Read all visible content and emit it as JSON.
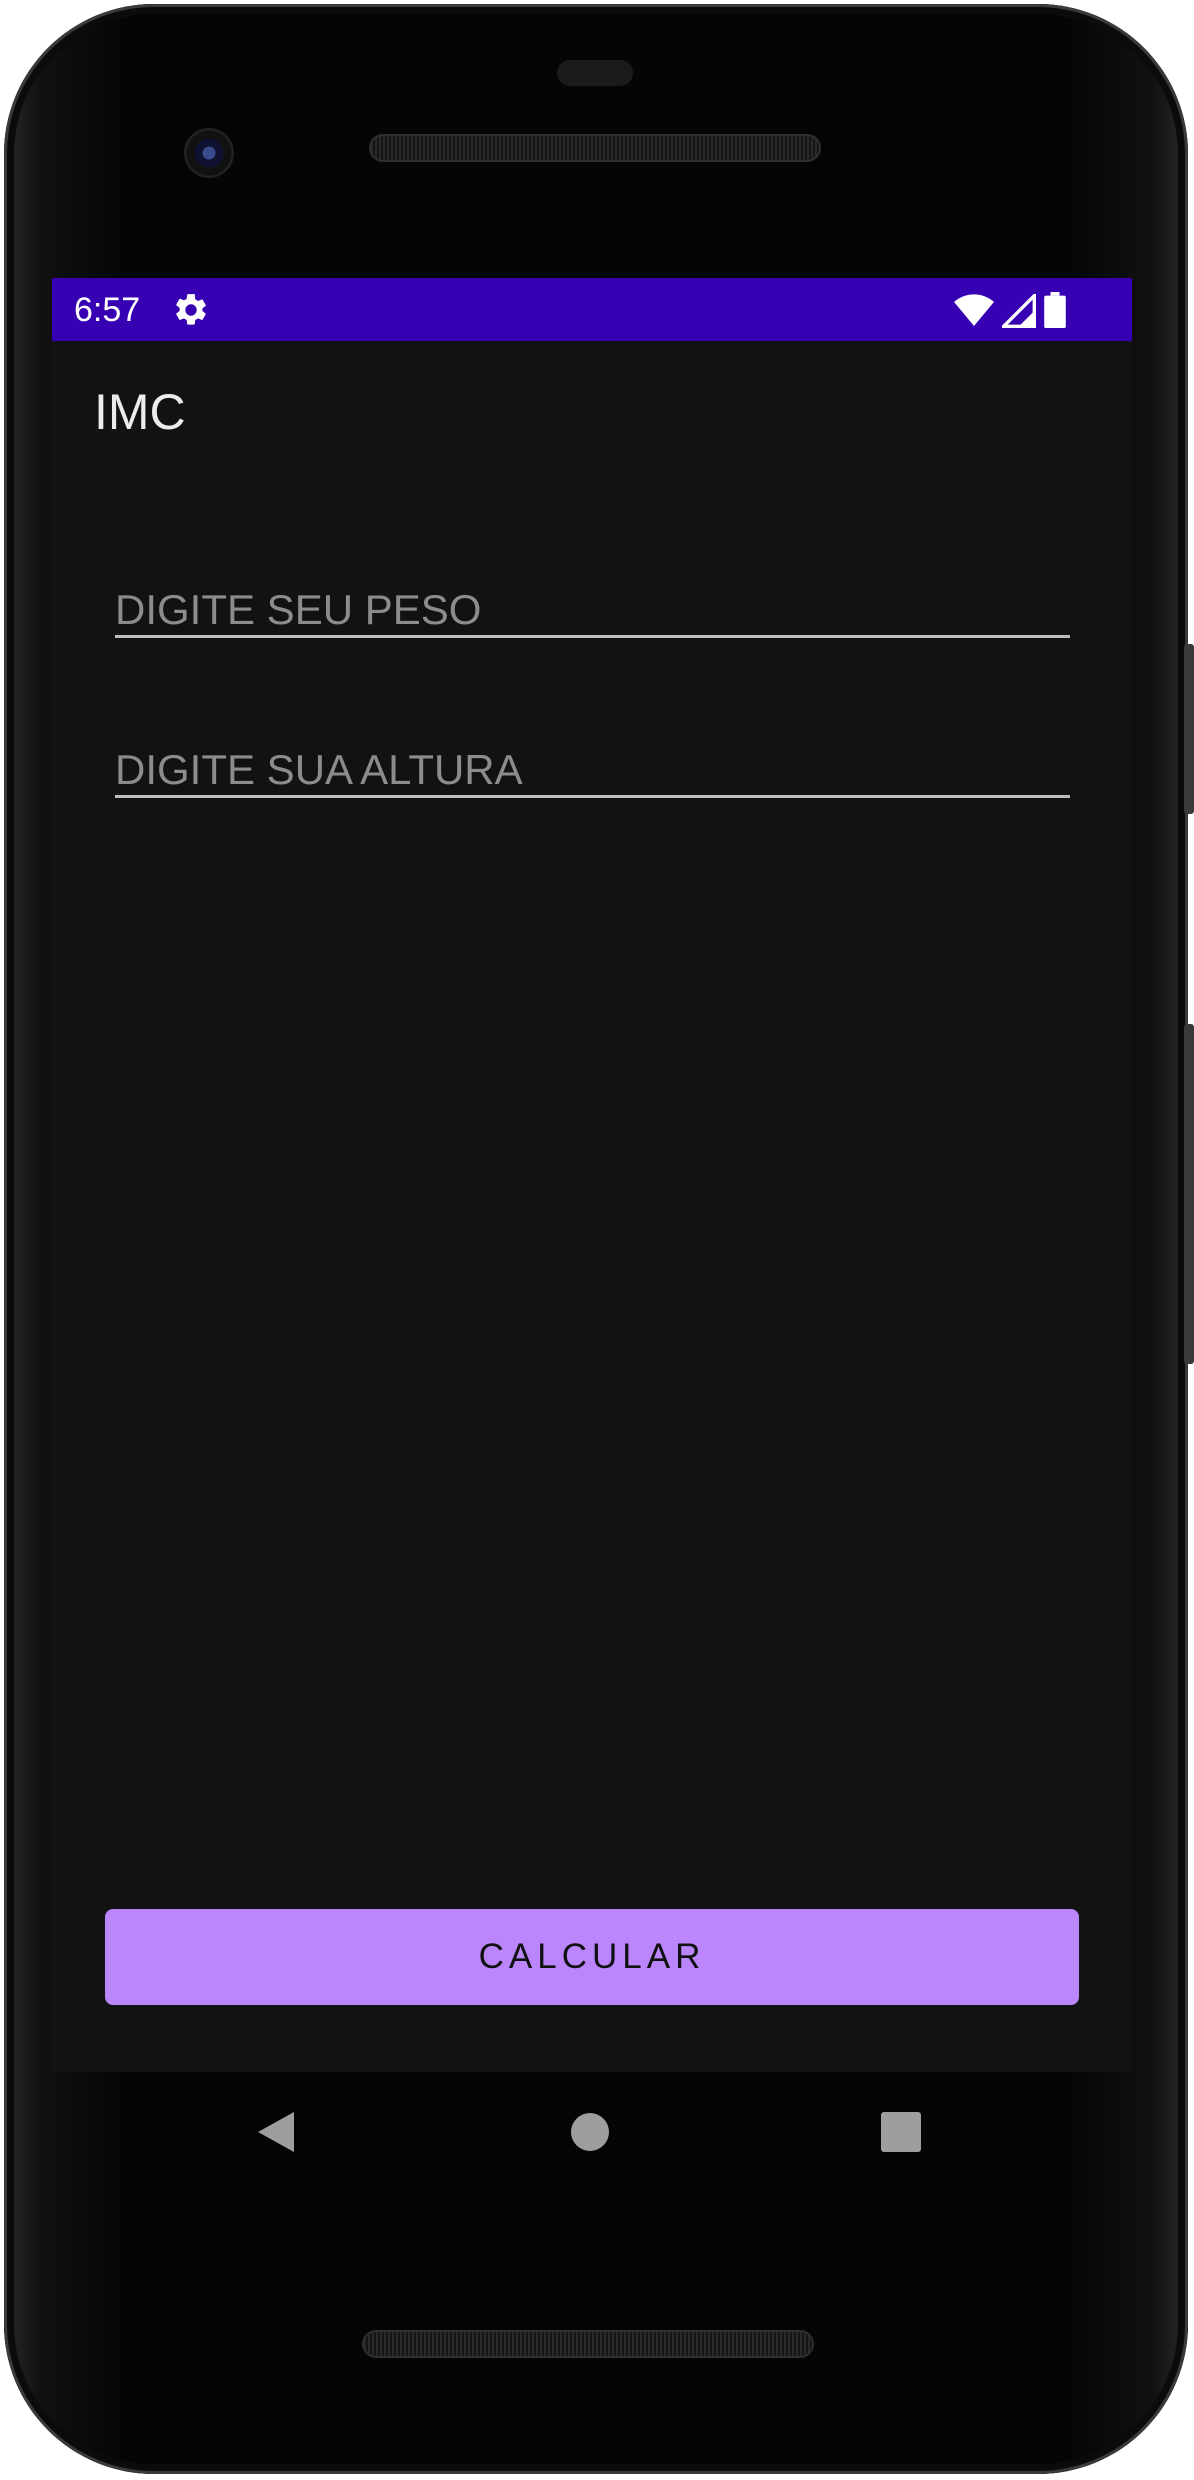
{
  "status_bar": {
    "time": "6:57",
    "icons": [
      "gear-icon",
      "wifi-icon",
      "cell-signal-icon",
      "battery-icon"
    ],
    "background_color": "#3700b3"
  },
  "app_bar": {
    "title": "IMC"
  },
  "form": {
    "weight_placeholder": "DIGITE SEU PESO",
    "weight_value": "",
    "height_placeholder": "DIGITE SUA ALTURA",
    "height_value": ""
  },
  "calculate_button": {
    "label": "CALCULAR",
    "color": "#bb86fc"
  },
  "nav_bar": {
    "icons": [
      "back-icon",
      "home-icon",
      "recents-icon"
    ]
  },
  "theme": {
    "screen_background": "#121212"
  }
}
